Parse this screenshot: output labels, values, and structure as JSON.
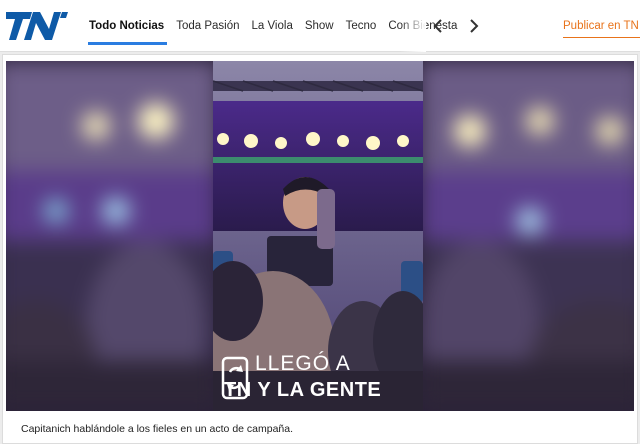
{
  "brand": {
    "name": "TN",
    "color": "#0e5aa7"
  },
  "nav": {
    "items": [
      {
        "label": "Todo Noticias",
        "active": true
      },
      {
        "label": "Toda Pasión",
        "active": false
      },
      {
        "label": "La Viola",
        "active": false
      },
      {
        "label": "Show",
        "active": false
      },
      {
        "label": "Tecno",
        "active": false
      },
      {
        "label": "Con Bienesta",
        "active": false
      }
    ],
    "prev_icon": "chevron-left-icon",
    "next_icon": "chevron-right-icon",
    "publish_label": "Publicar en TN y",
    "accent_color": "#2a7de1",
    "publish_color": "#e8731a"
  },
  "media": {
    "overlay_line1": "LLEGÓ A",
    "overlay_line2": "TN Y LA GENTE",
    "overlay_icon": "phone-refresh-icon",
    "caption": "Capitanich hablándole a los fieles en un acto de campaña."
  }
}
